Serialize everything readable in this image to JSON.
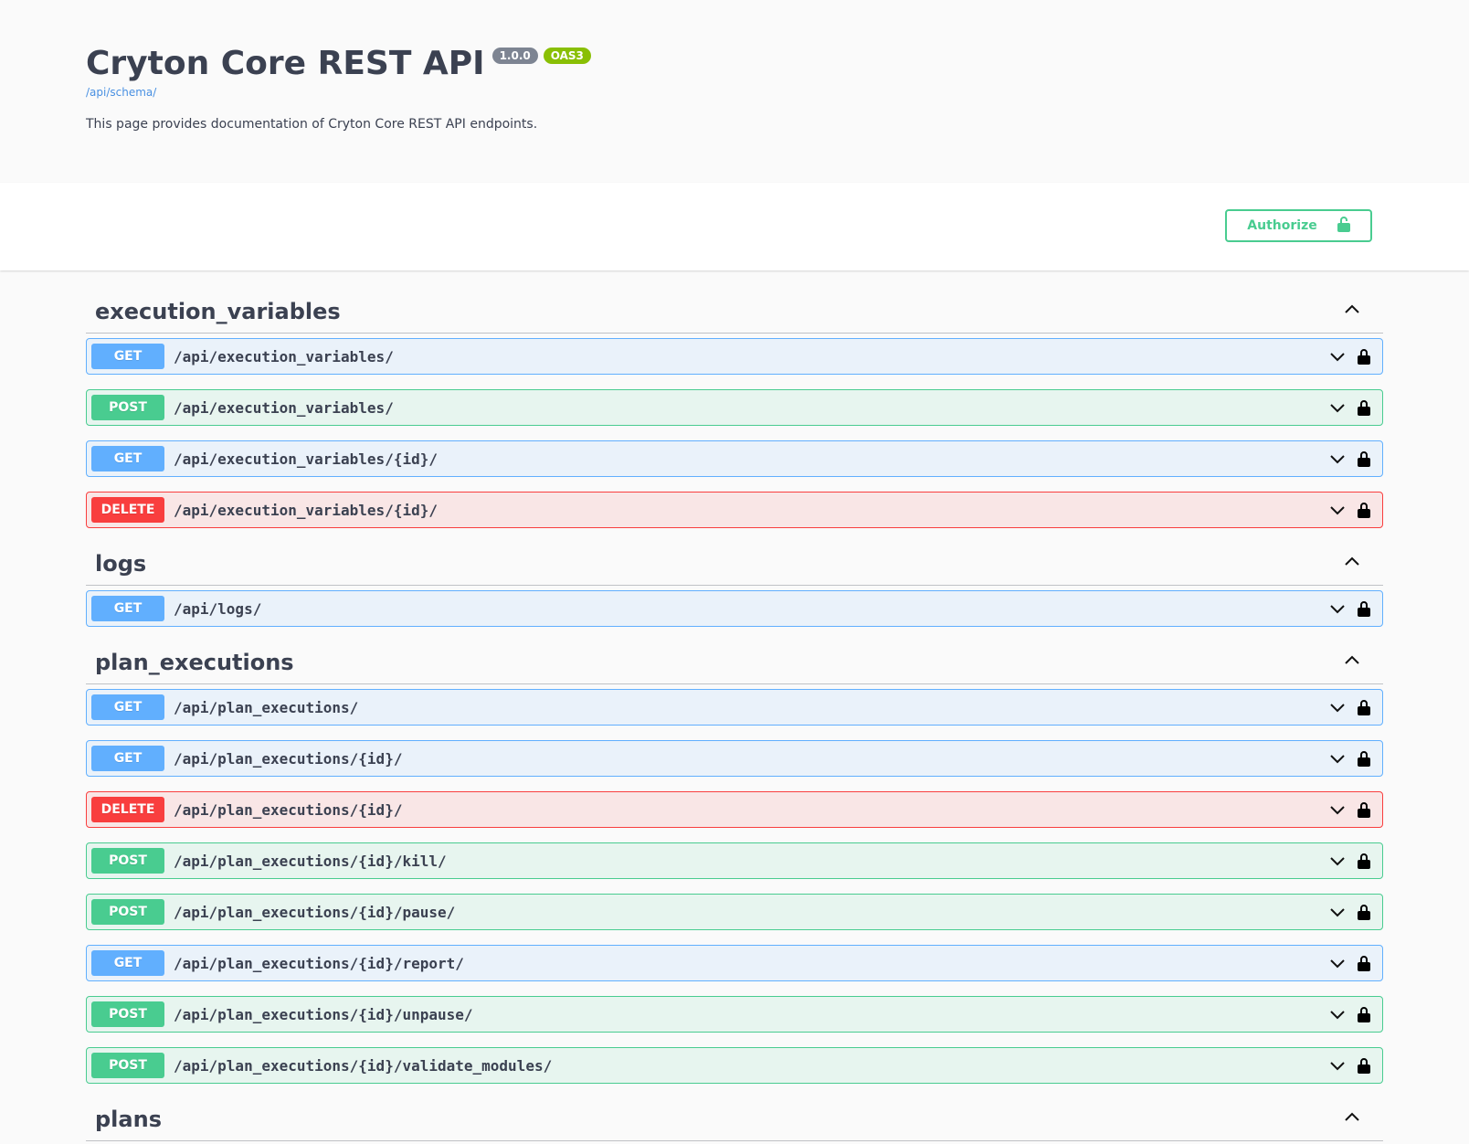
{
  "info": {
    "title": "Cryton Core REST API",
    "version_badge": "1.0.0",
    "oas_badge": "OAS3",
    "schema_link": "/api/schema/",
    "description": "This page provides documentation of Cryton Core REST API endpoints."
  },
  "scheme_bar": {
    "authorize_label": "Authorize"
  },
  "colors": {
    "get": "#61affe",
    "post": "#49cc90",
    "delete": "#f93e3e",
    "authorize": "#49cc90"
  },
  "tags": [
    {
      "name": "execution_variables",
      "operations": [
        {
          "method": "GET",
          "path": "/api/execution_variables/"
        },
        {
          "method": "POST",
          "path": "/api/execution_variables/"
        },
        {
          "method": "GET",
          "path": "/api/execution_variables/{id}/"
        },
        {
          "method": "DELETE",
          "path": "/api/execution_variables/{id}/"
        }
      ]
    },
    {
      "name": "logs",
      "operations": [
        {
          "method": "GET",
          "path": "/api/logs/"
        }
      ]
    },
    {
      "name": "plan_executions",
      "operations": [
        {
          "method": "GET",
          "path": "/api/plan_executions/"
        },
        {
          "method": "GET",
          "path": "/api/plan_executions/{id}/"
        },
        {
          "method": "DELETE",
          "path": "/api/plan_executions/{id}/"
        },
        {
          "method": "POST",
          "path": "/api/plan_executions/{id}/kill/"
        },
        {
          "method": "POST",
          "path": "/api/plan_executions/{id}/pause/"
        },
        {
          "method": "GET",
          "path": "/api/plan_executions/{id}/report/"
        },
        {
          "method": "POST",
          "path": "/api/plan_executions/{id}/unpause/"
        },
        {
          "method": "POST",
          "path": "/api/plan_executions/{id}/validate_modules/"
        }
      ]
    },
    {
      "name": "plans",
      "operations": []
    }
  ]
}
